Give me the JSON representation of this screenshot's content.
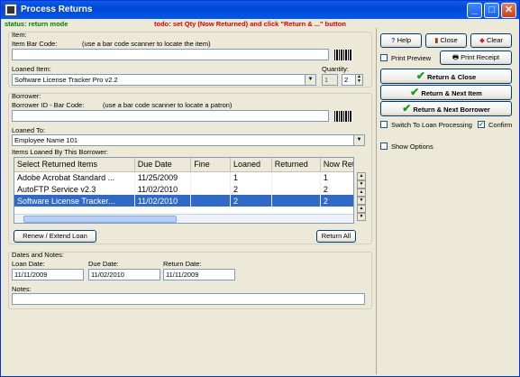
{
  "window": {
    "title": "Process Returns"
  },
  "status": {
    "mode": "status: return mode",
    "todo": "todo: set Qty (Now Returned) and click \"Return & ...\" button"
  },
  "item": {
    "group_label": "Item:",
    "barcode_label": "Item Bar Code:",
    "barcode_hint": "(use a bar code scanner to locate the item)",
    "barcode_value": "",
    "loaned_item_label": "Loaned Item:",
    "loaned_item_value": "Software License Tracker Pro v2.2",
    "quantity_label": "Quantity:",
    "quantity_total": "1",
    "quantity_value": "2"
  },
  "borrower": {
    "group_label": "Borrower:",
    "id_label": "Borrower ID - Bar Code:",
    "id_hint": "(use a bar code scanner to locate a patron)",
    "id_value": "",
    "loaned_to_label": "Loaned To:",
    "loaned_to_value": "Employee Name 101",
    "items_label": "Items Loaned By This Borrower:"
  },
  "table": {
    "columns": [
      "Select Returned Items",
      "Due Date",
      "Fine",
      "Loaned",
      "Returned",
      "Now Retu"
    ],
    "rows": [
      [
        "Adobe Acrobat Standard ...",
        "11/25/2009",
        "",
        "1",
        "",
        "1"
      ],
      [
        "AutoFTP Service v2.3",
        "11/02/2010",
        "",
        "2",
        "",
        "2"
      ],
      [
        "Software License Tracker...",
        "11/02/2010",
        "",
        "2",
        "",
        "2"
      ]
    ]
  },
  "buttons": {
    "renew": "Renew / Extend Loan",
    "return_all": "Return All",
    "help": "Help",
    "close": "Close",
    "clear": "Clear",
    "print_preview": "Print Preview",
    "print_receipt": "Print Receipt",
    "return_close": "Return & Close",
    "return_next_item": "Return & Next Item",
    "return_next_borrower": "Return & Next Borrower"
  },
  "options": {
    "switch_loan": "Switch To Loan Processing",
    "confirm": "Confirm",
    "show_options": "Show Options"
  },
  "dates": {
    "group_label": "Dates and Notes:",
    "loan_label": "Loan Date:",
    "loan_value": "11/11/2009",
    "due_label": "Due Date:",
    "due_value": "11/02/2010",
    "return_label": "Return Date:",
    "return_value": "11/11/2009",
    "notes_label": "Notes:",
    "notes_value": ""
  },
  "colors": {
    "status_green": "#008000",
    "todo_red": "#e00000",
    "accent_blue": "#0058ee"
  }
}
